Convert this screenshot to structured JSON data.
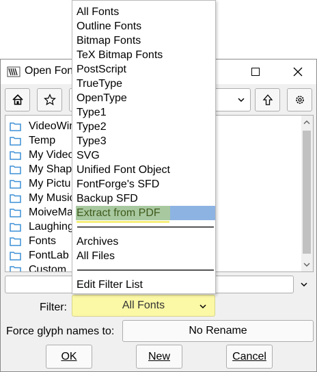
{
  "window": {
    "title": "Open Font"
  },
  "files": [
    "VideoWin",
    "Temp",
    "My Video",
    "My Shape",
    "My Pictu",
    "My Music",
    "MoiveMa",
    "Laughing",
    "Fonts",
    "FontLab",
    "Custom"
  ],
  "filter_menu": {
    "group1": [
      "All Fonts",
      "Outline Fonts",
      "Bitmap Fonts",
      "TeX Bitmap Fonts",
      "PostScript",
      "TrueType",
      "OpenType",
      "Type1",
      "Type2",
      "Type3",
      "SVG",
      "Unified Font Object",
      "FontForge's SFD",
      "Backup SFD",
      "Extract from PDF"
    ],
    "group2": [
      "Archives",
      "All Files"
    ],
    "group3": [
      "Edit Filter List"
    ],
    "selected": "Extract from PDF"
  },
  "filter": {
    "label": "Filter:",
    "value": "All Fonts"
  },
  "rename": {
    "label": "Force glyph names to:",
    "value": "No Rename"
  },
  "buttons": {
    "ok": "OK",
    "new": "New",
    "cancel": "Cancel"
  },
  "colors": {
    "highlight": "#8db3e2",
    "marker": "#fbf8a6",
    "folder": "#3b8fd6"
  },
  "icons": [
    "fontforge-app-icon",
    "home-icon",
    "star-icon",
    "chevron-down-icon",
    "up-arrow-icon",
    "gear-icon",
    "folder-icon",
    "maximize-icon",
    "close-icon"
  ]
}
